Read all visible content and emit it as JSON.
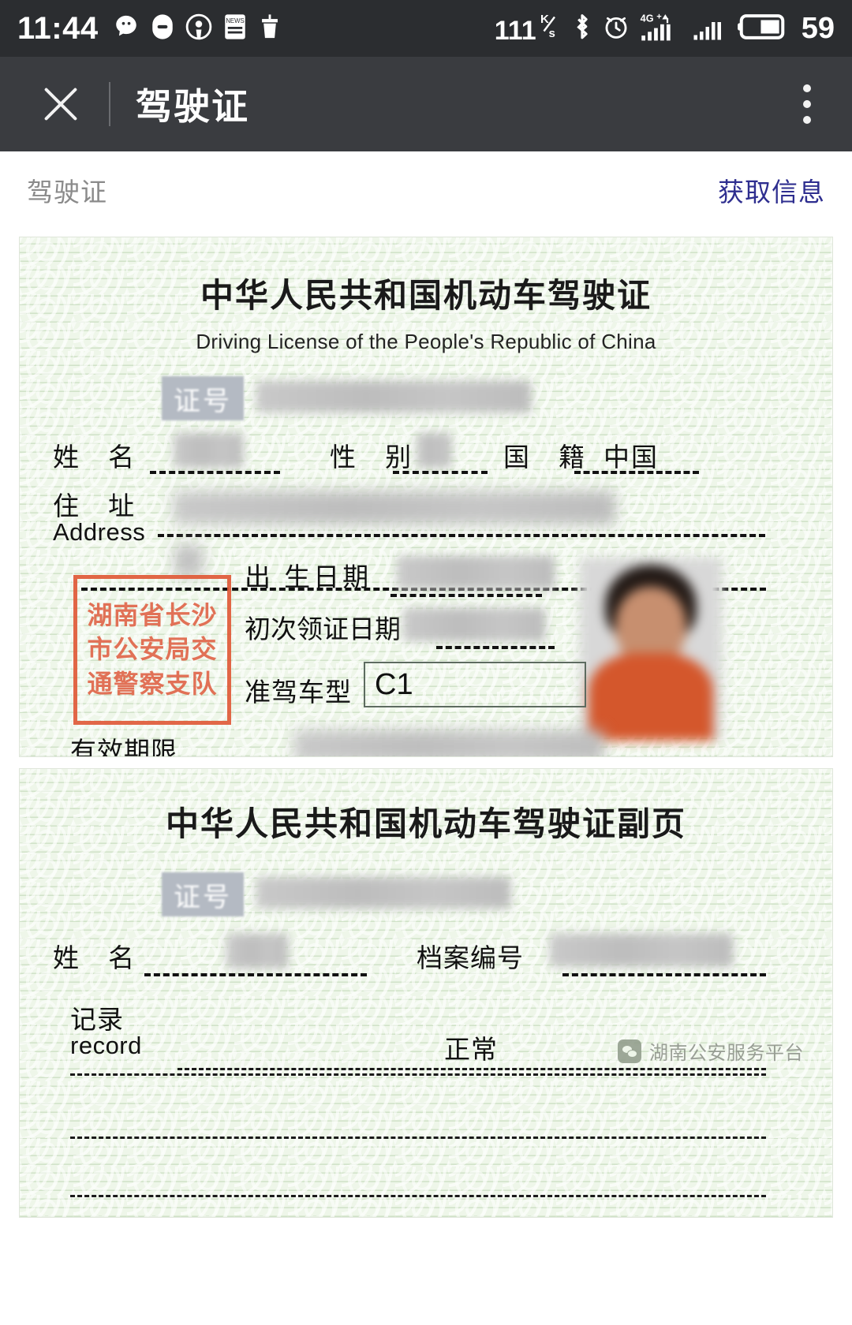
{
  "status_bar": {
    "time": "11:44",
    "left_icons": [
      "chat-bubble-icon",
      "message-icon",
      "podcast-icon",
      "news-icon",
      "cleaner-icon"
    ],
    "network_speed": "111",
    "network_speed_unit_top": "K",
    "network_speed_unit_bottom": "s",
    "right_icons": [
      "bluetooth-icon",
      "alarm-clock-icon",
      "signal-4g-plus-icon",
      "signal-bars-icon",
      "battery-icon"
    ],
    "network_type": "4G+",
    "battery_percent": "59"
  },
  "nav_bar": {
    "close_label": "close-icon",
    "title": "驾驶证",
    "more_label": "more-options-icon"
  },
  "sub_header": {
    "title": "驾驶证",
    "action_label": "获取信息",
    "action_color": "#2e2e8f"
  },
  "license_main": {
    "title": "中华人民共和国机动车驾驶证",
    "title_en": "Driving License of the People's Republic of China",
    "id_tag": "证号",
    "id_value": "",
    "fields": {
      "name_label": "姓 名",
      "name_value": "",
      "sex_label": "性 别",
      "sex_value": "",
      "nationality_label": "国 籍",
      "nationality_value": "中国",
      "address_label": "住 址",
      "address_label_en": "Address",
      "address_value": "",
      "birth_label": "出 生日期",
      "birth_value": "",
      "first_issue_label": "初次领证日期",
      "first_issue_value": "",
      "class_label": "准驾车型",
      "class_value": "C1",
      "valid_label": "有效期限",
      "valid_value": ""
    },
    "stamp_lines": [
      "湖南省长沙",
      "市公安局交",
      "通警察支队"
    ],
    "stamp_color": "#e05a38"
  },
  "license_sub": {
    "title": "中华人民共和国机动车驾驶证副页",
    "id_tag": "证号",
    "id_value": "",
    "fields": {
      "name_label": "姓 名",
      "name_value": "",
      "file_no_label": "档案编号",
      "file_no_value": "",
      "record_label": "记录",
      "record_label_en": "record",
      "record_value": "正常"
    }
  },
  "watermark": {
    "text": "湖南公安服务平台",
    "logo": "wechat-official-account-icon"
  }
}
